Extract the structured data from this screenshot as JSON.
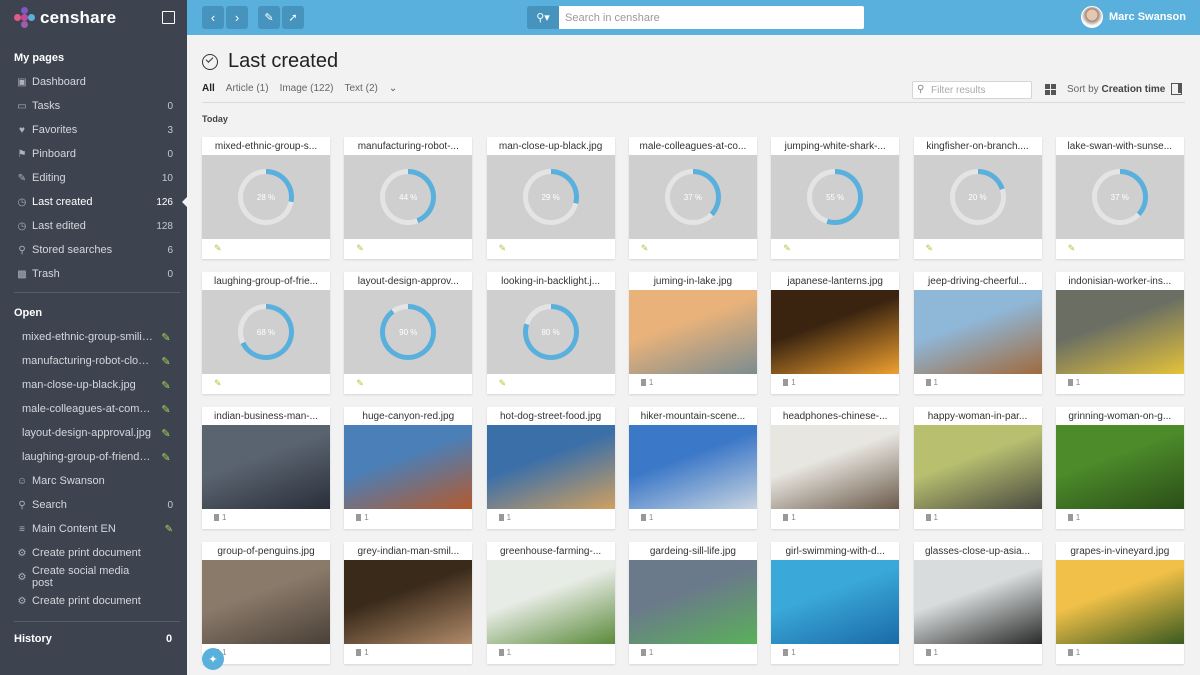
{
  "app": {
    "name": "censhare"
  },
  "colors": {
    "accent": "#5ab0dc",
    "sidebar": "#3d4450",
    "progress_track": "#e4e4e4",
    "edit_pen": "#a5d65a"
  },
  "search": {
    "placeholder": "Search in censhare"
  },
  "user": {
    "name": "Marc Swanson"
  },
  "sidebar": {
    "my_pages_heading": "My pages",
    "items": [
      {
        "icon": "dashboard-icon",
        "label": "Dashboard",
        "count": ""
      },
      {
        "icon": "inbox-icon",
        "label": "Tasks",
        "count": "0"
      },
      {
        "icon": "heart-icon",
        "label": "Favorites",
        "count": "3"
      },
      {
        "icon": "pin-icon",
        "label": "Pinboard",
        "count": "0"
      },
      {
        "icon": "pencil-icon",
        "label": "Editing",
        "count": "10"
      },
      {
        "icon": "check-circle-icon",
        "label": "Last created",
        "count": "126",
        "active": true
      },
      {
        "icon": "check-circle-icon",
        "label": "Last edited",
        "count": "128"
      },
      {
        "icon": "search-icon",
        "label": "Stored searches",
        "count": "6"
      },
      {
        "icon": "trash-icon",
        "label": "Trash",
        "count": "0"
      }
    ],
    "open_heading": "Open",
    "open_items": [
      {
        "label": "mixed-ethnic-group-smiling.jpg"
      },
      {
        "label": "manufacturing-robot-close-up.jpg"
      },
      {
        "label": "man-close-up-black.jpg"
      },
      {
        "label": "male-colleagues-at-computer.jpg"
      },
      {
        "label": "layout-design-approval.jpg"
      },
      {
        "label": "laughing-group-of-friends.jpg"
      }
    ],
    "more_items": [
      {
        "icon": "user-icon",
        "label": "Marc Swanson",
        "count": "",
        "pen": false
      },
      {
        "icon": "search-icon",
        "label": "Search",
        "count": "0",
        "pen": false
      },
      {
        "icon": "list-icon",
        "label": "Main Content EN",
        "count": "",
        "pen": true
      },
      {
        "icon": "gear-icon",
        "label": "Create print document",
        "count": "",
        "pen": false
      },
      {
        "icon": "gear-icon",
        "label": "Create social media post",
        "count": "",
        "pen": false
      },
      {
        "icon": "gear-icon",
        "label": "Create print document",
        "count": "",
        "pen": false
      }
    ],
    "history_heading": "History",
    "history_count": "0"
  },
  "main": {
    "title": "Last created",
    "tabs": [
      {
        "label": "All",
        "active": true
      },
      {
        "label": "Article (1)"
      },
      {
        "label": "Image (122)"
      },
      {
        "label": "Text (2)"
      }
    ],
    "filter_placeholder": "Filter results",
    "sort_prefix": "Sort by",
    "sort_value": "Creation time",
    "group_label": "Today"
  },
  "cards": [
    {
      "title": "mixed-ethnic-group-s...",
      "type": "progress",
      "percent": 28,
      "percent_label": "28 %"
    },
    {
      "title": "manufacturing-robot-...",
      "type": "progress",
      "percent": 44,
      "percent_label": "44 %"
    },
    {
      "title": "man-close-up-black.jpg",
      "type": "progress",
      "percent": 29,
      "percent_label": "29 %"
    },
    {
      "title": "male-colleagues-at-co...",
      "type": "progress",
      "percent": 37,
      "percent_label": "37 %"
    },
    {
      "title": "jumping-white-shark-...",
      "type": "progress",
      "percent": 55,
      "percent_label": "55 %"
    },
    {
      "title": "kingfisher-on-branch....",
      "type": "progress",
      "percent": 20,
      "percent_label": "20 %"
    },
    {
      "title": "lake-swan-with-sunse...",
      "type": "progress",
      "percent": 37,
      "percent_label": "37 %"
    },
    {
      "title": "laughing-group-of-frie...",
      "type": "progress",
      "percent": 68,
      "percent_label": "68 %"
    },
    {
      "title": "layout-design-approv...",
      "type": "progress",
      "percent": 90,
      "percent_label": "90 %"
    },
    {
      "title": "looking-in-backlight.j...",
      "type": "progress",
      "percent": 80,
      "percent_label": "80 %"
    },
    {
      "title": "juming-in-lake.jpg",
      "type": "image",
      "count": "1",
      "colors": [
        "#e8b27a",
        "#7c8c90"
      ]
    },
    {
      "title": "japanese-lanterns.jpg",
      "type": "image",
      "count": "1",
      "colors": [
        "#3a2410",
        "#f0a030"
      ]
    },
    {
      "title": "jeep-driving-cheerful...",
      "type": "image",
      "count": "1",
      "colors": [
        "#8fb7d8",
        "#a06a3c"
      ]
    },
    {
      "title": "indonisian-worker-ins...",
      "type": "image",
      "count": "1",
      "colors": [
        "#6b6f63",
        "#e4c23a"
      ]
    },
    {
      "title": "indian-business-man-...",
      "type": "image",
      "count": "1",
      "colors": [
        "#5a6470",
        "#2a2f3a"
      ]
    },
    {
      "title": "huge-canyon-red.jpg",
      "type": "image",
      "count": "1",
      "colors": [
        "#4a7fb8",
        "#b45a2c"
      ]
    },
    {
      "title": "hot-dog-street-food.jpg",
      "type": "image",
      "count": "1",
      "colors": [
        "#3b6fa8",
        "#d0a060"
      ]
    },
    {
      "title": "hiker-mountain-scene...",
      "type": "image",
      "count": "1",
      "colors": [
        "#3c78c8",
        "#c8d4e0"
      ]
    },
    {
      "title": "headphones-chinese-...",
      "type": "image",
      "count": "1",
      "colors": [
        "#e8e6e0",
        "#6b5a4a"
      ]
    },
    {
      "title": "happy-woman-in-par...",
      "type": "image",
      "count": "1",
      "colors": [
        "#b8c070",
        "#4a4a40"
      ]
    },
    {
      "title": "grinning-woman-on-g...",
      "type": "image",
      "count": "1",
      "colors": [
        "#4c8a2a",
        "#2a4e18"
      ]
    },
    {
      "title": "group-of-penguins.jpg",
      "type": "image",
      "count": "1",
      "colors": [
        "#8a7a6a",
        "#4a4038"
      ]
    },
    {
      "title": "grey-indian-man-smil...",
      "type": "image",
      "count": "1",
      "colors": [
        "#3a2a1a",
        "#b08a6a"
      ]
    },
    {
      "title": "greenhouse-farming-...",
      "type": "image",
      "count": "1",
      "colors": [
        "#e8ece6",
        "#5a8a3a"
      ]
    },
    {
      "title": "gardeing-sill-life.jpg",
      "type": "image",
      "count": "1",
      "colors": [
        "#6a7a8a",
        "#5ab05a"
      ]
    },
    {
      "title": "girl-swimming-with-d...",
      "type": "image",
      "count": "1",
      "colors": [
        "#3aa8d8",
        "#1a6aa8"
      ]
    },
    {
      "title": "glasses-close-up-asia...",
      "type": "image",
      "count": "1",
      "colors": [
        "#d8dcdc",
        "#2a2a2a"
      ]
    },
    {
      "title": "grapes-in-vineyard.jpg",
      "type": "image",
      "count": "1",
      "colors": [
        "#f0c048",
        "#3a5a20"
      ]
    }
  ]
}
